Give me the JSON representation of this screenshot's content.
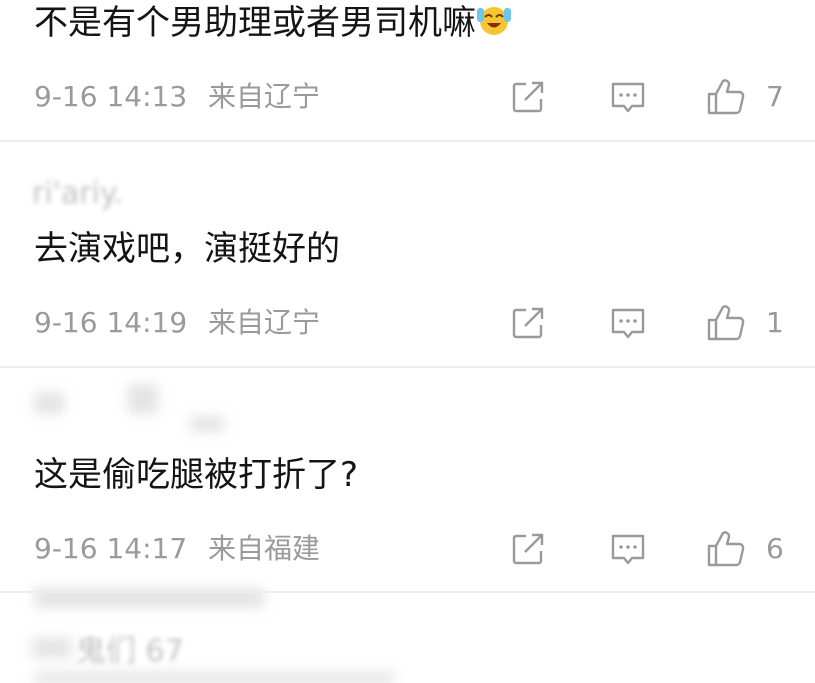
{
  "comments": [
    {
      "text": "不是有个男助理或者男司机嘛",
      "emoji": "laughing-crying-emoji",
      "time": "9-16 14:13",
      "location": "来自辽宁",
      "likes": "7"
    },
    {
      "text": "去演戏吧，演挺好的",
      "time": "9-16 14:19",
      "location": "来自辽宁",
      "likes": "1"
    },
    {
      "text": "这是偷吃腿被打折了?",
      "time": "9-16 14:17",
      "location": "来自福建",
      "likes": "6"
    }
  ],
  "icons": {
    "share": "share-icon",
    "reply": "comment-icon",
    "like": "thumbs-up-icon"
  },
  "colors": {
    "meta_text": "#9a9a9a",
    "body_text": "#141414",
    "icon": "#9a9a9a",
    "divider": "#ededed"
  }
}
